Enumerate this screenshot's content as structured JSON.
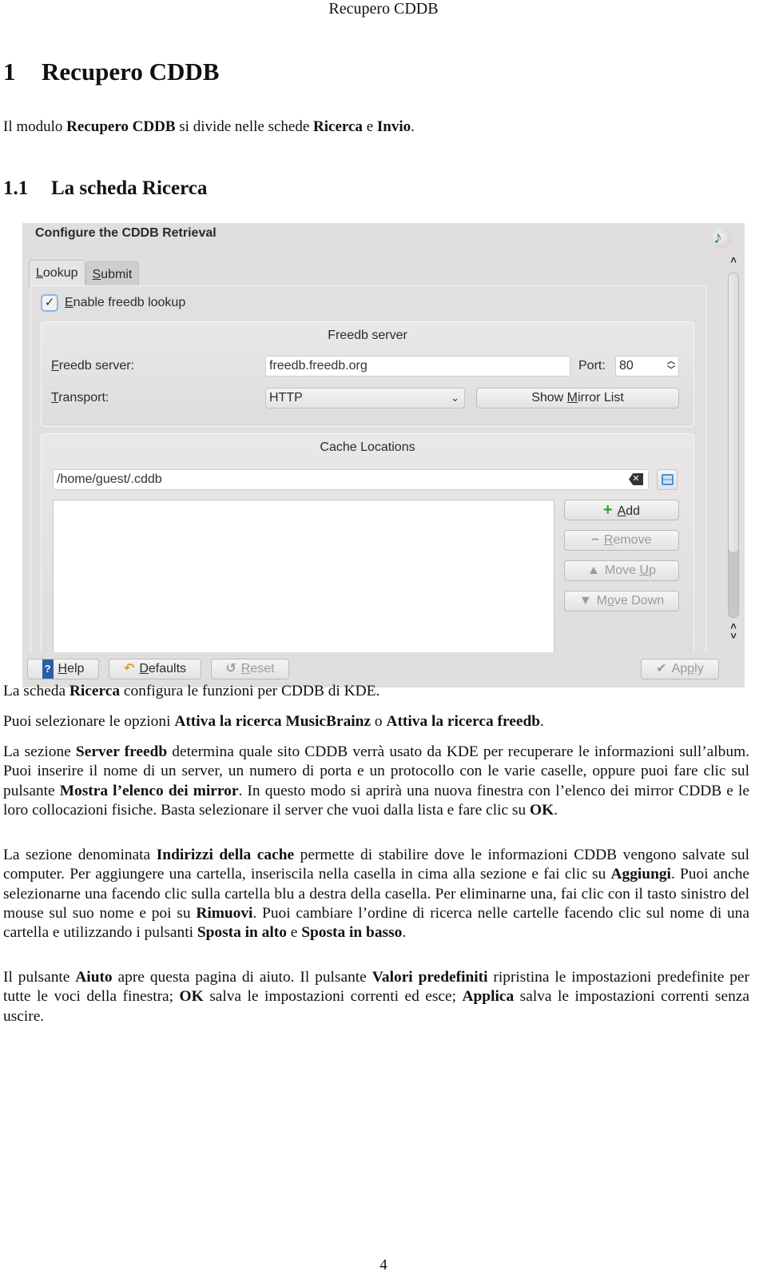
{
  "running_header": "Recupero CDDB",
  "section": {
    "number": "1",
    "title": "Recupero CDDB"
  },
  "intro": {
    "t1": "Il modulo ",
    "b1": "Recupero CDDB",
    "t2": " si divide nelle schede ",
    "b2": "Ricerca",
    "t3": " e ",
    "b3": "Invio",
    "t4": "."
  },
  "subsection": {
    "number": "1.1",
    "title": "La scheda Ricerca"
  },
  "dialog": {
    "title": "Configure the CDDB Retrieval",
    "app_icon": "music-note-cd-icon",
    "tabs": [
      {
        "accel": "L",
        "rest": "ookup",
        "active": true
      },
      {
        "accel": "S",
        "rest": "ubmit",
        "active": false
      }
    ],
    "enable_lookup": {
      "accel": "E",
      "rest": "nable freedb lookup",
      "checked": true
    },
    "freedb_group": {
      "title": "Freedb server",
      "server_label_accel": "F",
      "server_label_rest": "reedb server:",
      "server_value": "freedb.freedb.org",
      "port_label": "Port:",
      "port_value": "80",
      "transport_label_accel": "T",
      "transport_label_rest": "ransport:",
      "transport_value": "HTTP",
      "mirror_button_pre": "Show ",
      "mirror_button_accel": "M",
      "mirror_button_post": "irror List"
    },
    "cache_group": {
      "title": "Cache Locations",
      "path_value": "/home/guest/.cddb",
      "locations": [],
      "buttons": {
        "add": {
          "icon": "+",
          "accel": "A",
          "rest": "dd",
          "enabled": true
        },
        "remove": {
          "icon": "−",
          "accel": "R",
          "rest": "emove",
          "enabled": false
        },
        "move_up": {
          "icon": "▲",
          "pre": "Move ",
          "accel": "U",
          "rest": "p",
          "enabled": false
        },
        "move_down": {
          "icon": "▼",
          "pre": "M",
          "accel": "o",
          "rest": "ve Down",
          "enabled": false
        }
      }
    },
    "footer": {
      "help": {
        "icon": "?",
        "accel": "H",
        "rest": "elp"
      },
      "defaults": {
        "icon": "↶",
        "accel": "D",
        "rest": "efaults"
      },
      "reset": {
        "icon": "↺",
        "accel": "R",
        "rest": "eset",
        "enabled": false
      },
      "apply": {
        "icon": "✔",
        "pre": "Ap",
        "accel": "p",
        "rest": "ly",
        "enabled": false
      }
    }
  },
  "paragraphs": {
    "p1": {
      "t1": "La scheda ",
      "b1": "Ricerca",
      "t2": " configura le funzioni per CDDB di KDE."
    },
    "p2": {
      "t1": "Puoi selezionare le opzioni ",
      "b1": "Attiva la ricerca MusicBrainz",
      "t2": " o ",
      "b2": "Attiva la ricerca freedb",
      "t3": "."
    },
    "p3": {
      "t1": "La sezione ",
      "b1": "Server freedb",
      "t2": " determina quale sito CDDB verrà usato da KDE per recuperare le informazioni sull’album. Puoi inserire il nome di un server, un numero di porta e un protocollo con le varie caselle, oppure puoi fare clic sul pulsante ",
      "b2": "Mostra l’elenco dei mirror",
      "t3": ". In questo modo si aprirà una nuova finestra con l’elenco dei mirror CDDB e le loro collocazioni fisiche. Basta selezionare il server che vuoi dalla lista e fare clic su ",
      "b3": "OK",
      "t4": "."
    },
    "p4": {
      "t1": "La sezione denominata ",
      "b1": "Indirizzi della cache",
      "t2": " permette di stabilire dove le informazioni CDDB vengono salvate sul computer. Per aggiungere una cartella, inseriscila nella casella in cima alla sezione e fai clic su ",
      "b2": "Aggiungi",
      "t3": ". Puoi anche selezionarne una facendo clic sulla cartella blu a destra della casella. Per eliminarne una, fai clic con il tasto sinistro del mouse sul suo nome e poi su ",
      "b3": "Rimuovi",
      "t4": ". Puoi cambiare l’ordine di ricerca nelle cartelle facendo clic sul nome di una cartella e utilizzando i pulsanti ",
      "b4": "Sposta in alto",
      "t5": " e ",
      "b5": "Sposta in basso",
      "t6": "."
    },
    "p5": {
      "t1": "Il pulsante ",
      "b1": "Aiuto",
      "t2": " apre questa pagina di aiuto. Il pulsante ",
      "b2": "Valori predefiniti",
      "t3": " ripristina le impostazioni predefinite per tutte le voci della finestra; ",
      "b3": "OK",
      "t4": " salva le impostazioni correnti ed esce; ",
      "b4": "Applica",
      "t5": " salva le impostazioni correnti senza uscire."
    }
  },
  "page_number": "4"
}
